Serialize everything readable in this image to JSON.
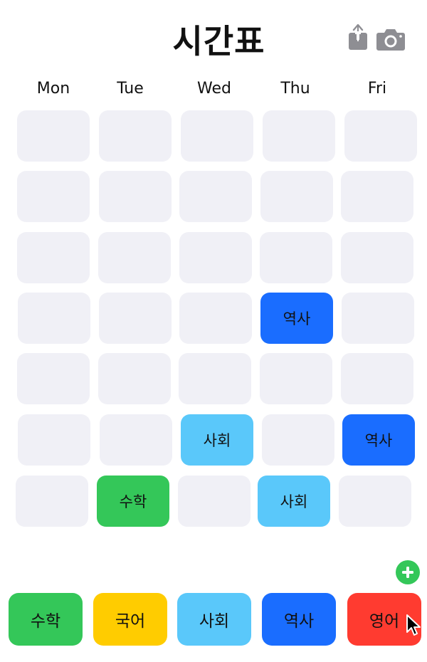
{
  "header": {
    "title": "시간표",
    "share_icon": "share-icon",
    "camera_icon": "camera-icon"
  },
  "days": [
    "Mon",
    "Tue",
    "Wed",
    "Thu",
    "Fri"
  ],
  "colors": {
    "empty": "#f0f0f6",
    "green": "#34c759",
    "yellow": "#ffcc00",
    "lightblue": "#5ac8fa",
    "blue": "#1a6dff",
    "red": "#ff3b30"
  },
  "timetable": [
    [
      "",
      "",
      "",
      "",
      ""
    ],
    [
      "",
      "",
      "",
      "",
      ""
    ],
    [
      "",
      "",
      "",
      "",
      ""
    ],
    [
      "",
      "",
      "",
      "역사",
      ""
    ],
    [
      "",
      "",
      "",
      "",
      ""
    ],
    [
      "",
      "",
      "사회",
      "",
      "역사"
    ],
    [
      "",
      "수학",
      "",
      "사회",
      ""
    ]
  ],
  "subjects": [
    {
      "label": "수학",
      "color": "#34c759"
    },
    {
      "label": "국어",
      "color": "#ffcc00"
    },
    {
      "label": "사회",
      "color": "#5ac8fa"
    },
    {
      "label": "역사",
      "color": "#1a6dff"
    },
    {
      "label": "영어",
      "color": "#ff3b30"
    }
  ],
  "add_button_icon": "plus-icon"
}
